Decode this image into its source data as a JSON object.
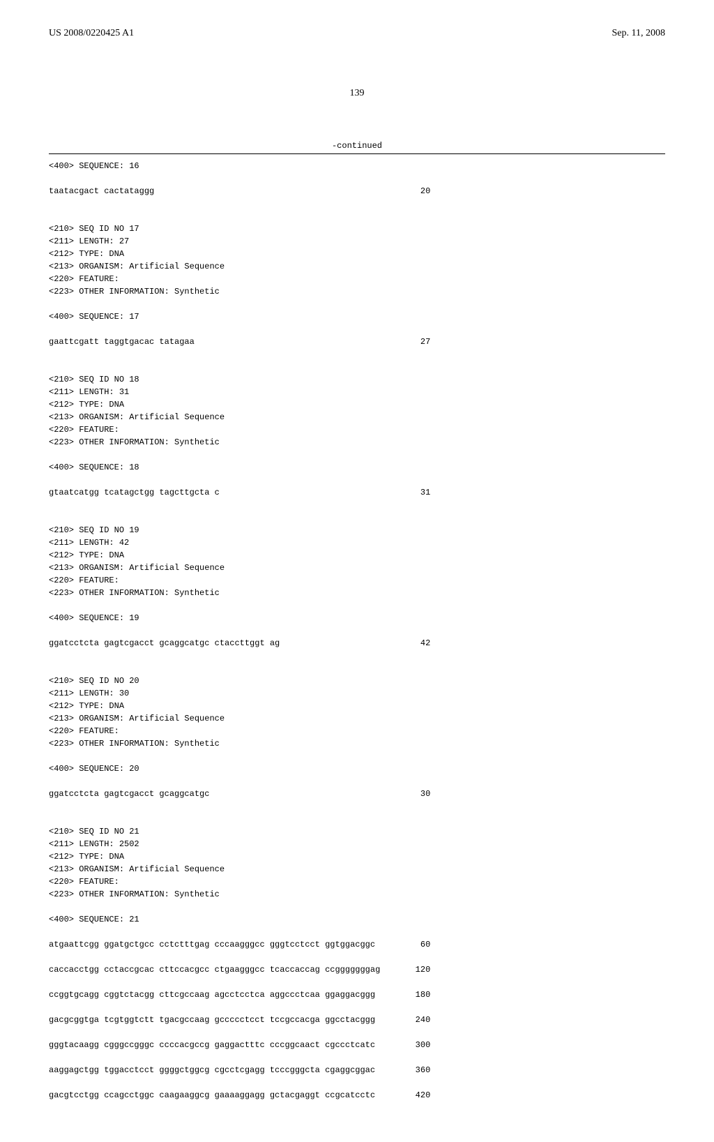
{
  "header": {
    "publication_number": "US 2008/0220425 A1",
    "date": "Sep. 11, 2008"
  },
  "page_number": "139",
  "continued_label": "-continued",
  "sequences": [
    {
      "title": "<400> SEQUENCE: 16",
      "header_lines": [],
      "seq_line": "taatacgact cactataggg",
      "seq_count": "20"
    },
    {
      "header_lines": [
        "<210> SEQ ID NO 17",
        "<211> LENGTH: 27",
        "<212> TYPE: DNA",
        "<213> ORGANISM: Artificial Sequence",
        "<220> FEATURE:",
        "<223> OTHER INFORMATION: Synthetic"
      ],
      "title": "<400> SEQUENCE: 17",
      "seq_line": "gaattcgatt taggtgacac tatagaa",
      "seq_count": "27"
    },
    {
      "header_lines": [
        "<210> SEQ ID NO 18",
        "<211> LENGTH: 31",
        "<212> TYPE: DNA",
        "<213> ORGANISM: Artificial Sequence",
        "<220> FEATURE:",
        "<223> OTHER INFORMATION: Synthetic"
      ],
      "title": "<400> SEQUENCE: 18",
      "seq_line": "gtaatcatgg tcatagctgg tagcttgcta c",
      "seq_count": "31"
    },
    {
      "header_lines": [
        "<210> SEQ ID NO 19",
        "<211> LENGTH: 42",
        "<212> TYPE: DNA",
        "<213> ORGANISM: Artificial Sequence",
        "<220> FEATURE:",
        "<223> OTHER INFORMATION: Synthetic"
      ],
      "title": "<400> SEQUENCE: 19",
      "seq_line": "ggatcctcta gagtcgacct gcaggcatgc ctaccttggt ag",
      "seq_count": "42"
    },
    {
      "header_lines": [
        "<210> SEQ ID NO 20",
        "<211> LENGTH: 30",
        "<212> TYPE: DNA",
        "<213> ORGANISM: Artificial Sequence",
        "<220> FEATURE:",
        "<223> OTHER INFORMATION: Synthetic"
      ],
      "title": "<400> SEQUENCE: 20",
      "seq_line": "ggatcctcta gagtcgacct gcaggcatgc",
      "seq_count": "30"
    },
    {
      "header_lines": [
        "<210> SEQ ID NO 21",
        "<211> LENGTH: 2502",
        "<212> TYPE: DNA",
        "<213> ORGANISM: Artificial Sequence",
        "<220> FEATURE:",
        "<223> OTHER INFORMATION: Synthetic"
      ],
      "title": "<400> SEQUENCE: 21",
      "multi_seq": [
        {
          "line": "atgaattcgg ggatgctgcc cctctttgag cccaagggcc gggtcctcct ggtggacggc",
          "count": "60"
        },
        {
          "line": "caccacctgg cctaccgcac cttccacgcc ctgaagggcc tcaccaccag ccgggggggag",
          "count": "120"
        },
        {
          "line": "ccggtgcagg cggtctacgg cttcgccaag agcctcctca aggccctcaa ggaggacggg",
          "count": "180"
        },
        {
          "line": "gacgcggtga tcgtggtctt tgacgccaag gccccctcct tccgccacga ggcctacggg",
          "count": "240"
        },
        {
          "line": "gggtacaagg cgggccgggc ccccacgccg gaggactttc cccggcaact cgccctcatc",
          "count": "300"
        },
        {
          "line": "aaggagctgg tggacctcct ggggctggcg cgcctcgagg tcccgggcta cgaggcggac",
          "count": "360"
        },
        {
          "line": "gacgtcctgg ccagcctggc caagaaggcg gaaaaggagg gctacgaggt ccgcatcctc",
          "count": "420"
        }
      ]
    }
  ]
}
